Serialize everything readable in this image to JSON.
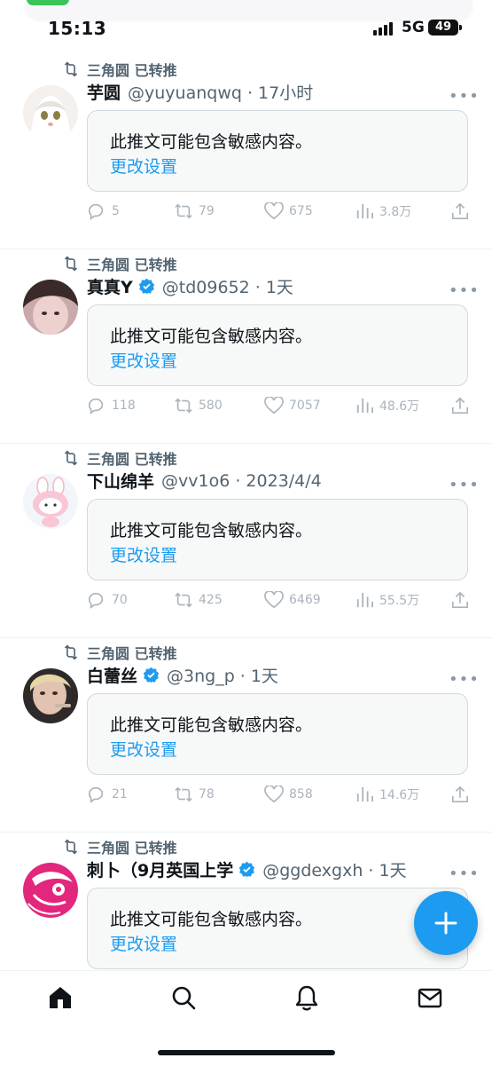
{
  "status_bar": {
    "time": "15:13",
    "network": "5G",
    "battery": "49"
  },
  "feed": {
    "tweets": [
      {
        "retweeter": "三角圆 已转推",
        "name": "芋圆",
        "verified": false,
        "handle": "@yuyuanqwq · 17小时",
        "notice": "此推文可能包含敏感内容。",
        "link": "更改设置",
        "replies": "5",
        "retweets": "79",
        "likes": "675",
        "views": "3.8万"
      },
      {
        "retweeter": "三角圆 已转推",
        "name": "真真Y",
        "verified": true,
        "handle": "@td09652 · 1天",
        "notice": "此推文可能包含敏感内容。",
        "link": "更改设置",
        "replies": "118",
        "retweets": "580",
        "likes": "7057",
        "views": "48.6万"
      },
      {
        "retweeter": "三角圆 已转推",
        "name": "下山绵羊",
        "verified": false,
        "handle": "@vv1o6 · 2023/4/4",
        "notice": "此推文可能包含敏感内容。",
        "link": "更改设置",
        "replies": "70",
        "retweets": "425",
        "likes": "6469",
        "views": "55.5万"
      },
      {
        "retweeter": "三角圆 已转推",
        "name": "白蕾丝",
        "verified": true,
        "handle": "@3ng_p · 1天",
        "notice": "此推文可能包含敏感内容。",
        "link": "更改设置",
        "replies": "21",
        "retweets": "78",
        "likes": "858",
        "views": "14.6万"
      },
      {
        "retweeter": "三角圆 已转推",
        "name": "刺卜（9月英国上学",
        "verified": true,
        "handle": "@ggdexgxh · 1天",
        "notice": "此推文可能包含敏感内容。",
        "link": "更改设置"
      }
    ]
  },
  "icons": {
    "compose": "plus-icon",
    "nav": [
      "home-icon",
      "search-icon",
      "bell-icon",
      "mail-icon"
    ]
  },
  "colors": {
    "accent": "#1d9bf0",
    "secondary_text": "#536471",
    "action_icon": "#aab4bc"
  }
}
